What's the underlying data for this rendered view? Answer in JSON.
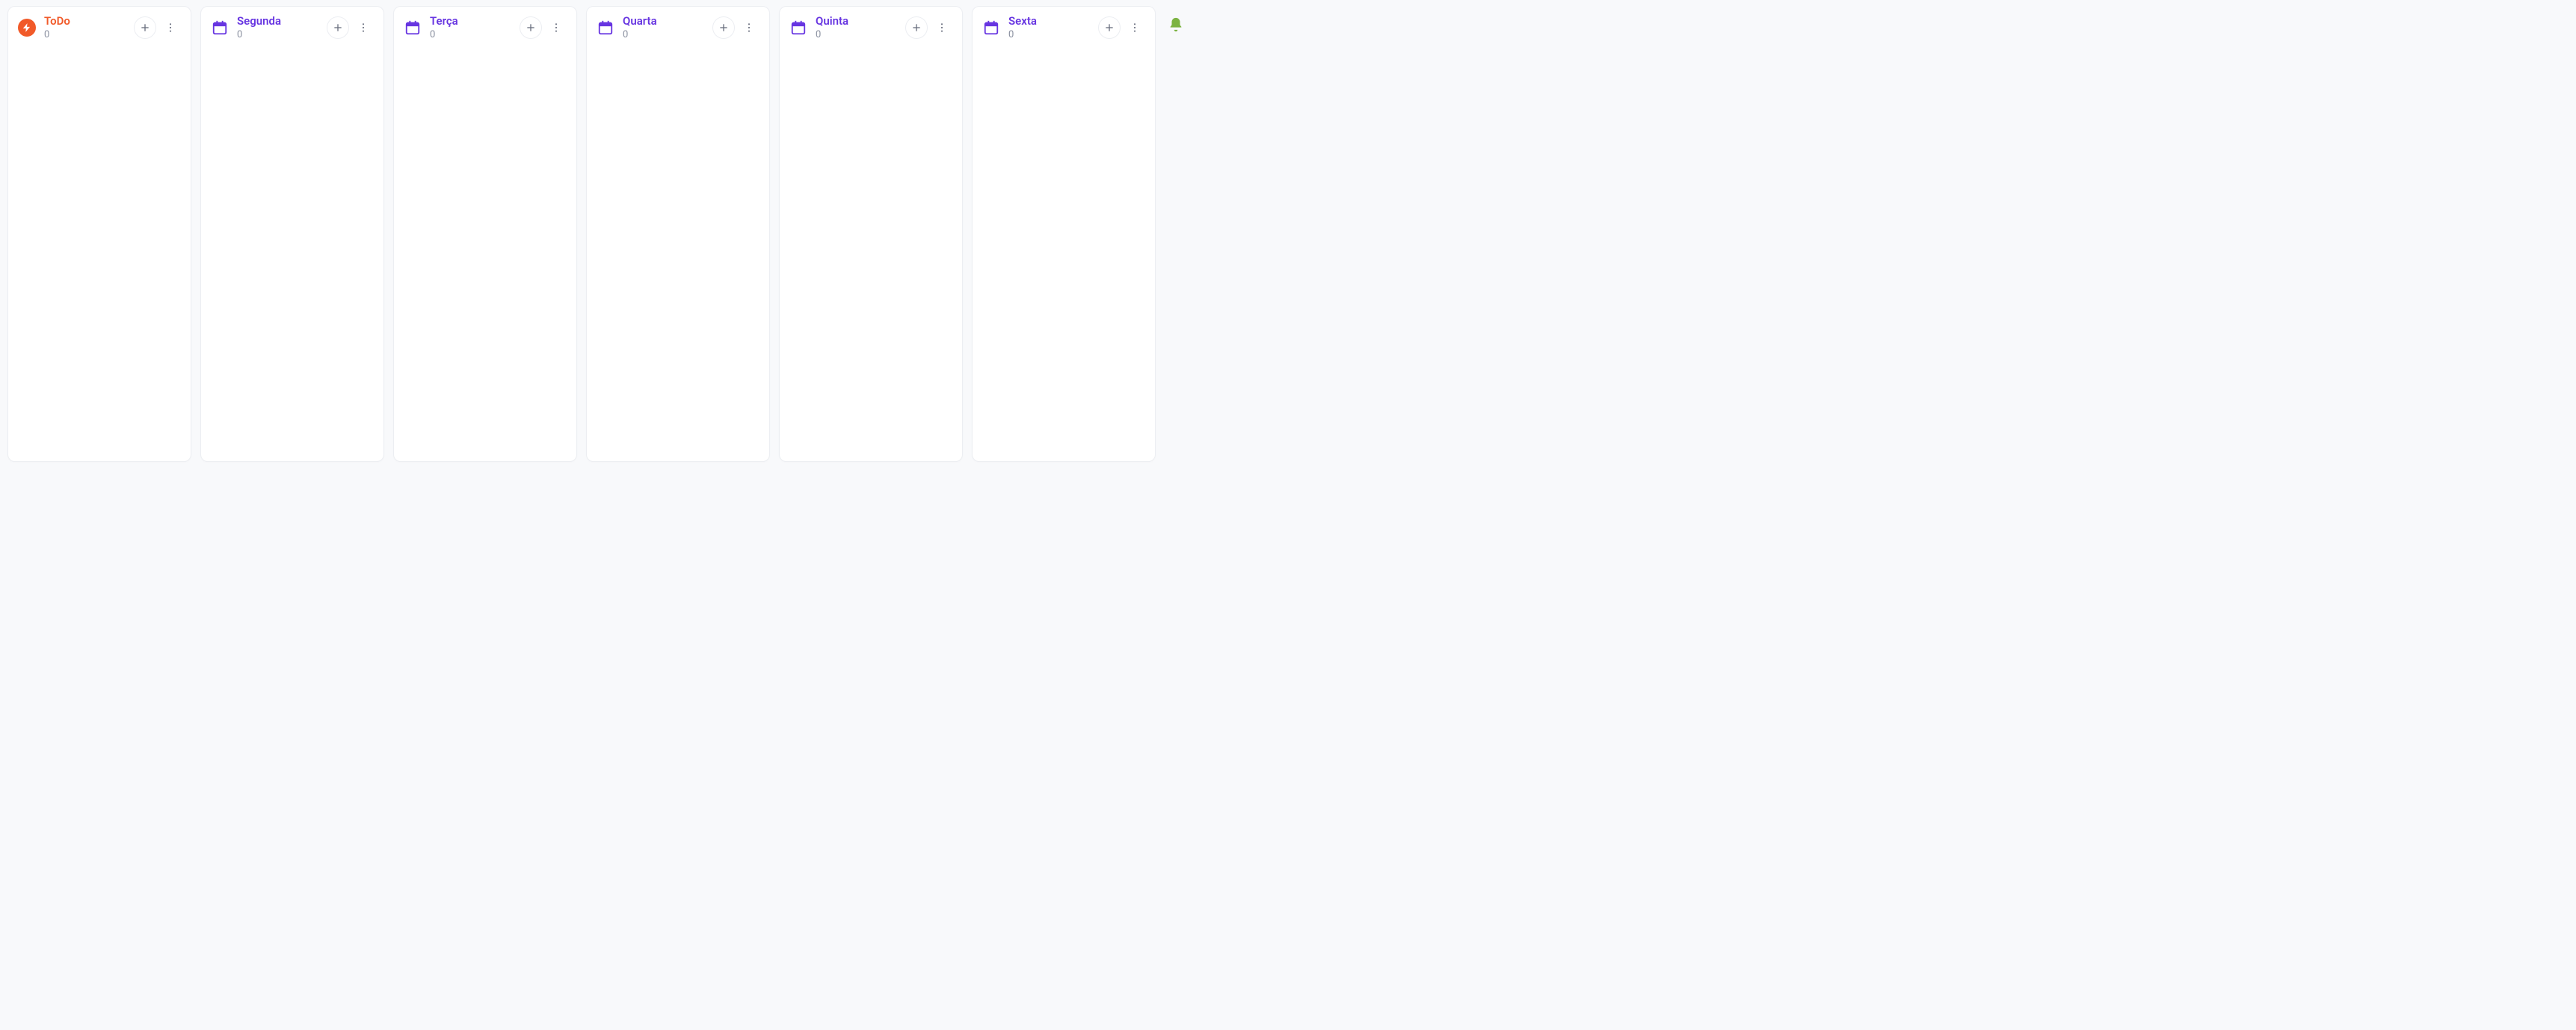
{
  "columns": [
    {
      "title": "ToDo",
      "count": "0",
      "variant": "todo"
    },
    {
      "title": "Segunda",
      "count": "0",
      "variant": "day"
    },
    {
      "title": "Terça",
      "count": "0",
      "variant": "day"
    },
    {
      "title": "Quarta",
      "count": "0",
      "variant": "day"
    },
    {
      "title": "Quinta",
      "count": "0",
      "variant": "day"
    },
    {
      "title": "Sexta",
      "count": "0",
      "variant": "day"
    }
  ]
}
